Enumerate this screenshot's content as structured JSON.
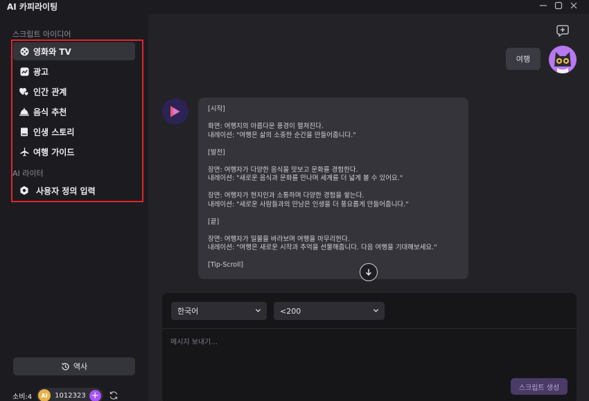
{
  "window": {
    "title": "AI 카피라이팅"
  },
  "sidebar": {
    "section_script": "스크립트 아이디어",
    "items": [
      {
        "label": "영화와 TV",
        "icon": "film-reel-icon",
        "active": true
      },
      {
        "label": "광고",
        "icon": "chart-icon"
      },
      {
        "label": "인간 관계",
        "icon": "hearts-icon"
      },
      {
        "label": "음식 추천",
        "icon": "food-cloche-icon"
      },
      {
        "label": "인생 스토리",
        "icon": "book-icon"
      },
      {
        "label": "여행 가이드",
        "icon": "airplane-icon"
      }
    ],
    "section_writer": "AI 라이터",
    "custom_item": {
      "label": "사용자 정의 입력",
      "icon": "gear-icon"
    },
    "history_label": "역사",
    "credits": {
      "label": "소비:4",
      "coin_label": "AI",
      "balance": "1012323",
      "plus": "+"
    }
  },
  "chat": {
    "user_message": "여행",
    "bot_message_lines": [
      "[시작]",
      "",
      "화면: 여행지의 아름다운 풍경이 펼쳐진다.",
      "내레이션: \"여행은 삶의 소중한 순간을 만들어줍니다.\"",
      "",
      "[발전]",
      "",
      "장면: 여행자가 다양한 음식을 맛보고 문화를 경험한다.",
      "내레이션: \"새로운 음식과 문화를 만나며 세계를 더 넓게 볼 수 있어요.\"",
      "",
      "장면: 여행자가 현지인과 소통하며 다양한 경험을 쌓는다.",
      "내레이션: \"새로운 사람들과의 만남은 인생을 더 풍요롭게 만들어줍니다.\"",
      "",
      "[끝]",
      "",
      "장면: 여행자가 일몰을 바라보며 여행을 마무리한다.",
      "내레이션: \"여행은 새로운 시작과 추억을 선물해줍니다. 다음 여행을 기대해보세요.\"",
      "",
      "[Tip-Scroll]"
    ]
  },
  "composer": {
    "language": "한국어",
    "length": "<200",
    "placeholder": "메시지 보내기...",
    "submit_label": "스크립트 생성"
  },
  "colors": {
    "accent": "#a855f7",
    "highlight_border": "#e0262d",
    "coin": "#e7b348"
  }
}
